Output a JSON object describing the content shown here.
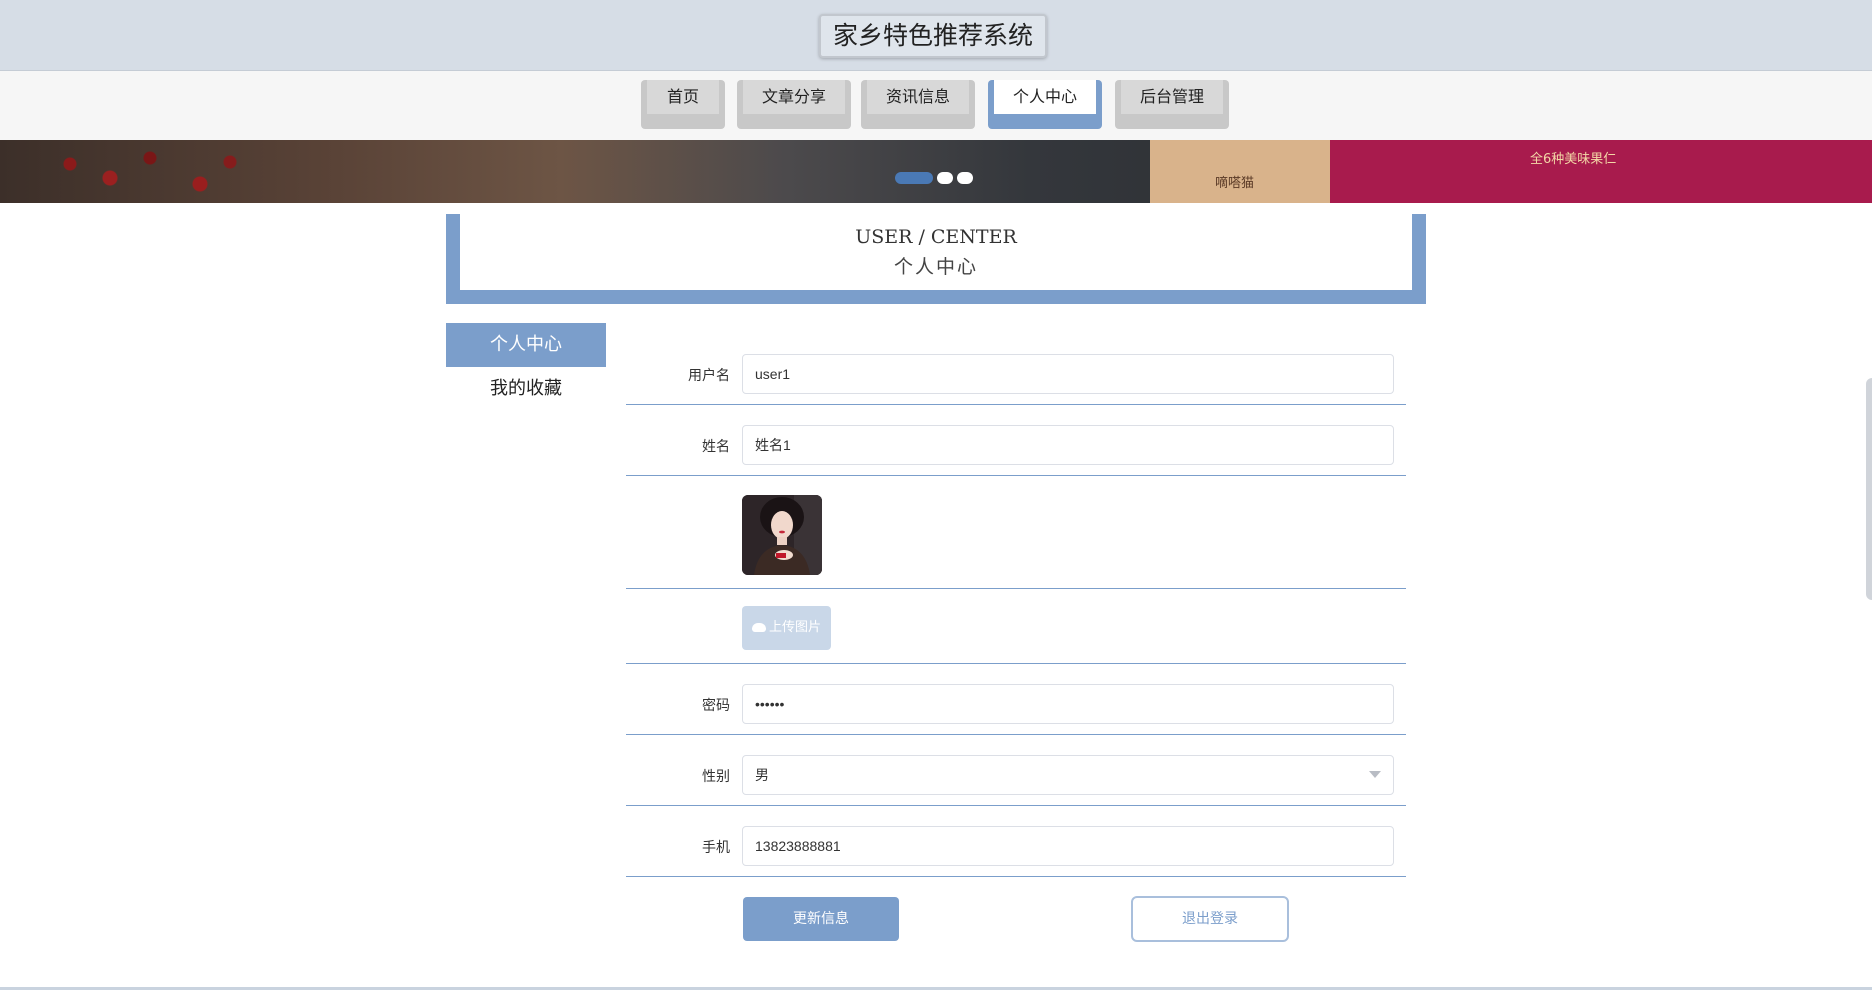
{
  "header": {
    "title": "家乡特色推荐系统"
  },
  "nav": {
    "items": [
      {
        "label": "首页",
        "active": false
      },
      {
        "label": "文章分享",
        "active": false
      },
      {
        "label": "资讯信息",
        "active": false
      },
      {
        "label": "个人中心",
        "active": true
      },
      {
        "label": "后台管理",
        "active": false
      }
    ]
  },
  "banner": {
    "pack_text": "全6种美味果仁",
    "box_text": "嘀嗒猫",
    "active_slide": 1,
    "slide_count": 3
  },
  "section": {
    "title_en": "USER / CENTER",
    "title_cn": "个人中心"
  },
  "side_menu": {
    "items": [
      {
        "label": "个人中心",
        "active": true
      },
      {
        "label": "我的收藏",
        "active": false
      }
    ]
  },
  "form": {
    "username": {
      "label": "用户名",
      "value": "user1"
    },
    "name": {
      "label": "姓名",
      "value": "姓名1"
    },
    "upload": {
      "label": "上传图片"
    },
    "password": {
      "label": "密码",
      "value": "••••••"
    },
    "gender": {
      "label": "性别",
      "value": "男"
    },
    "phone": {
      "label": "手机",
      "value": "13823888881"
    },
    "update_button": "更新信息",
    "logout_button": "退出登录"
  },
  "colors": {
    "accent": "#7b9ecb",
    "topbar": "#d6dde6"
  }
}
